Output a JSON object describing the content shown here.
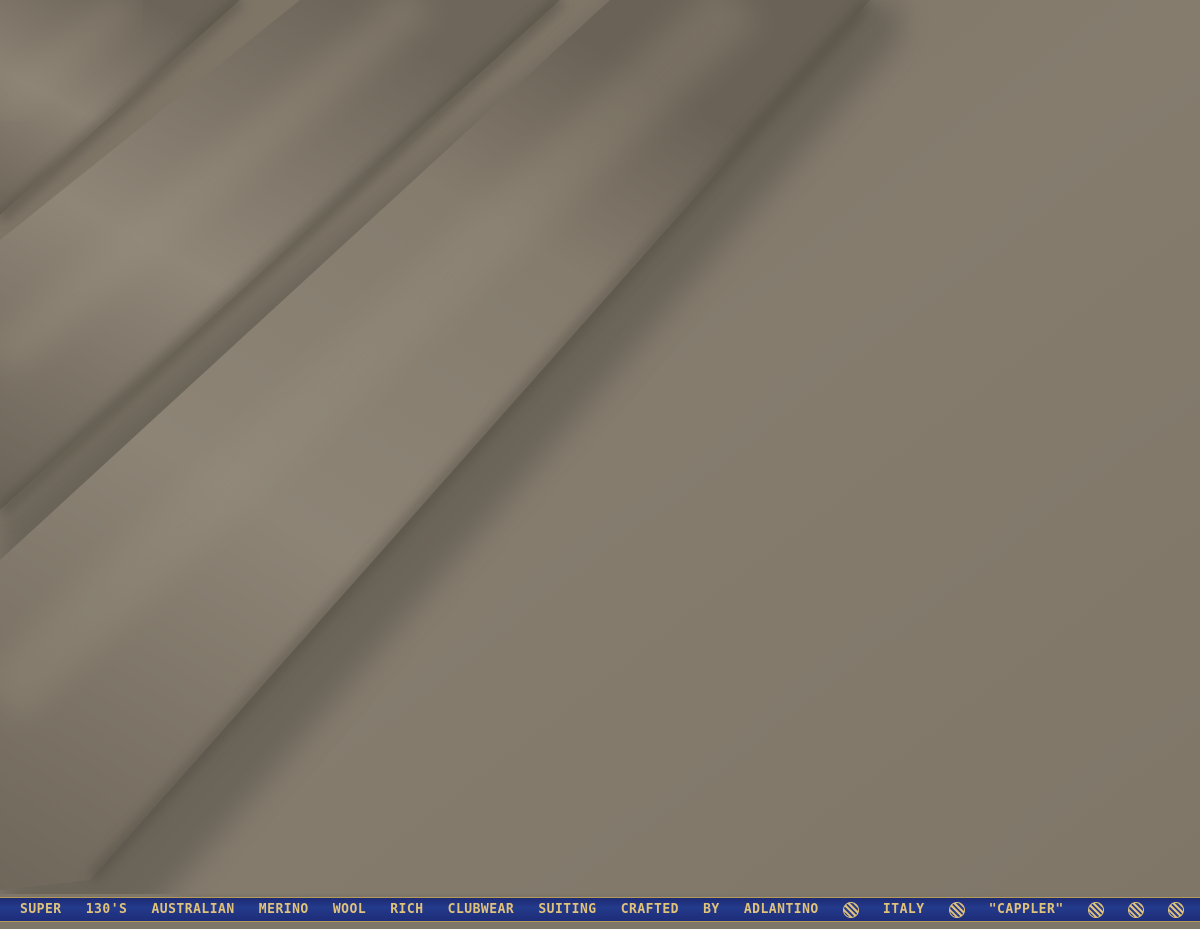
{
  "photo": {
    "subject": "fabric-swatch",
    "colors": {
      "fabric_base": "#857c6e",
      "fold_highlight": "#958c7e",
      "fold_shadow": "#564f45",
      "selvedge_band": "#243a8c",
      "selvedge_text": "#e0c27a"
    }
  },
  "selvedge": {
    "words": [
      "SUPER",
      "130'S",
      "AUSTRALIAN",
      "MERINO",
      "WOOL",
      "RICH",
      "CLUBWEAR",
      "SUITING",
      "CRAFTED",
      "BY",
      "ADLANTINO",
      "ITALY",
      "\"CAPPLER\""
    ]
  }
}
